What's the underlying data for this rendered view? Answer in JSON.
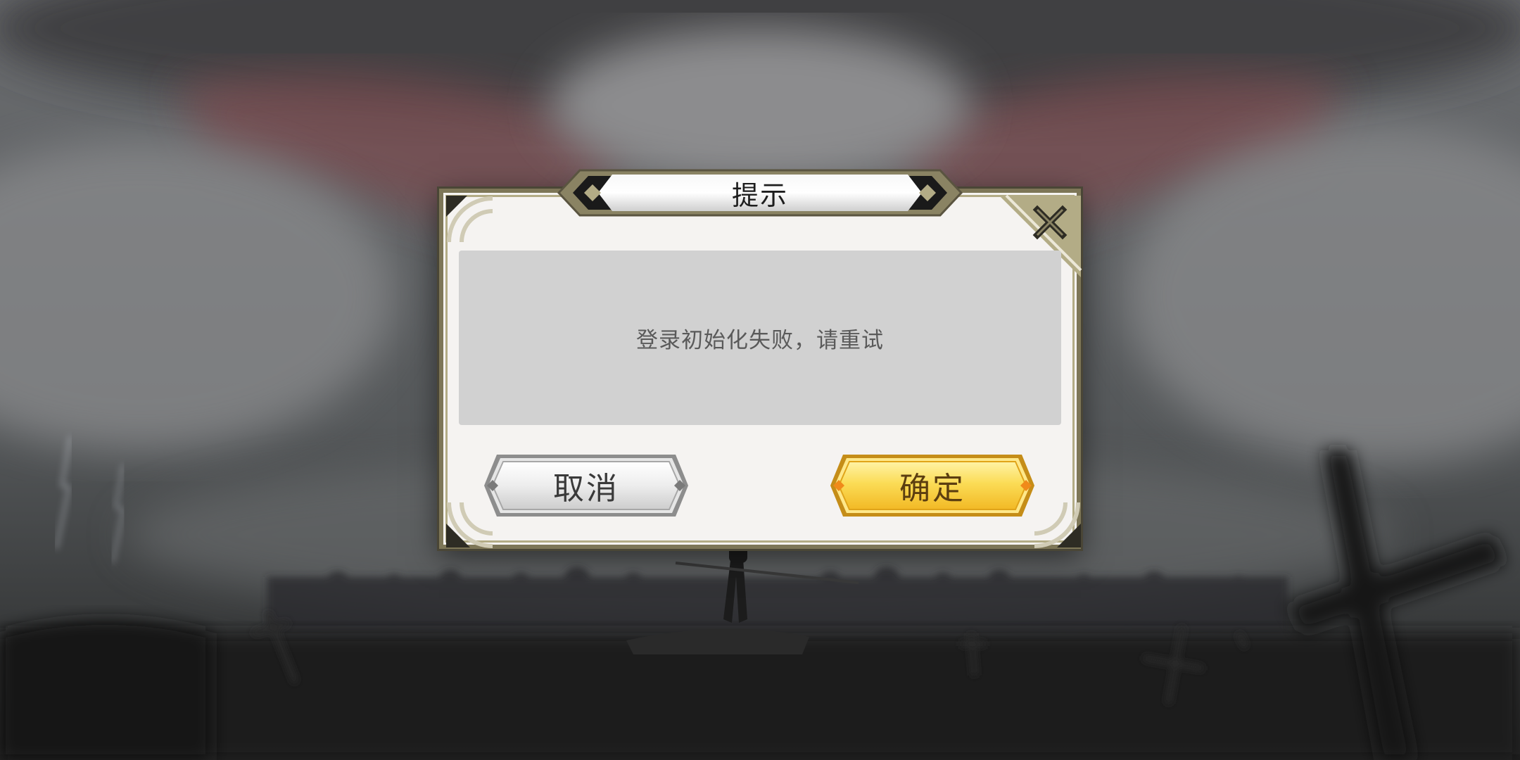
{
  "dialog": {
    "title": "提示",
    "message": "登录初始化失败，请重试",
    "cancel_label": "取消",
    "confirm_label": "确定",
    "close_icon": "close-x-icon"
  },
  "colors": {
    "frame": "#7d7657",
    "frame_light": "#b3ac86",
    "panel": "#d1d1d1",
    "confirm_gold": "#f7c93a",
    "cancel_silver": "#e6e6e6"
  }
}
